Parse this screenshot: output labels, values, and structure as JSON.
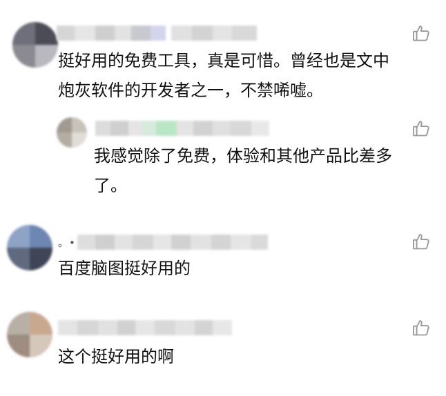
{
  "comments": [
    {
      "text": "挺好用的免费工具，真是可惜。曾经也是文中\n炮灰软件的开发者之一，不禁唏嘘。",
      "like_icon": "thumbs-up-icon",
      "reply": {
        "text": "我感觉除了免费，体验和其他产品比差多\n了。",
        "like_icon": "thumbs-up-icon"
      }
    },
    {
      "name_prefix": "。•",
      "text": "百度脑图挺好用的",
      "like_icon": "thumbs-up-icon"
    },
    {
      "text": "这个挺好用的啊",
      "like_icon": "thumbs-up-icon"
    }
  ],
  "colors": {
    "text": "#111111",
    "icon": "#999999",
    "blur_gray": "#d9d9d9"
  }
}
